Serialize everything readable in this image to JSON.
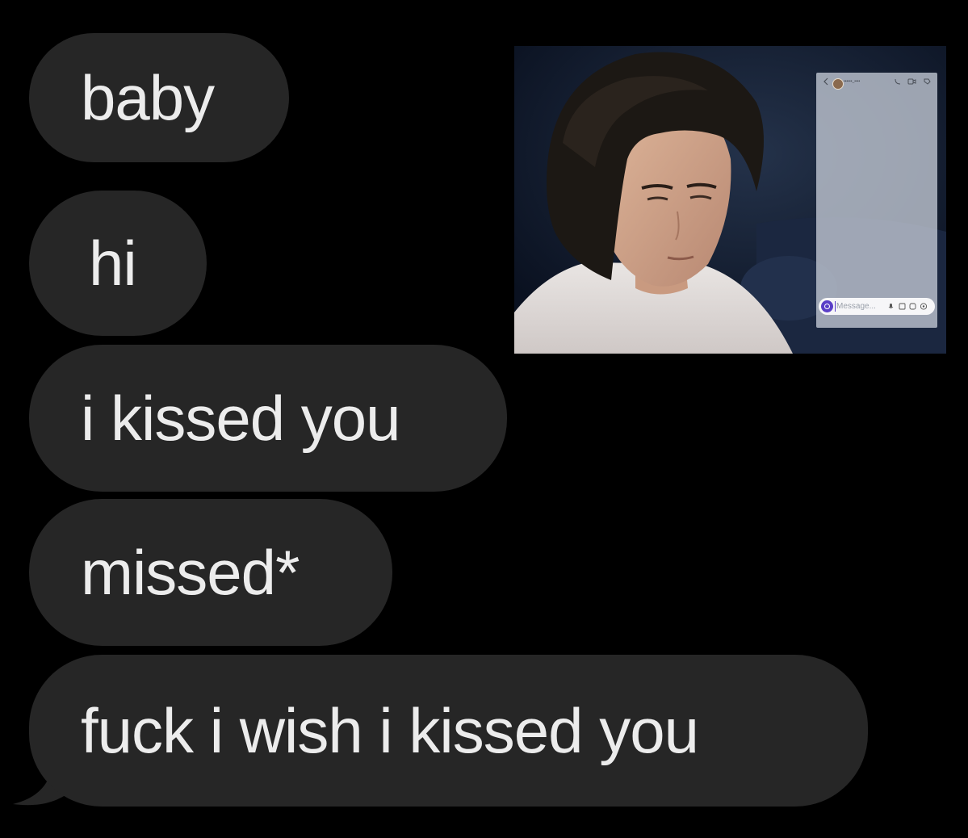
{
  "messages": [
    {
      "text": "baby"
    },
    {
      "text": "hi"
    },
    {
      "text": "i kissed you"
    },
    {
      "text": "missed*"
    },
    {
      "text": "fuck i wish i kissed you"
    }
  ],
  "inset": {
    "chat_overlay": {
      "username": "••••••_••••",
      "input_placeholder": "Message..."
    }
  },
  "colors": {
    "background": "#000000",
    "bubble": "#262626",
    "bubble_text": "#ececec",
    "accent": "#5a3fc7"
  }
}
